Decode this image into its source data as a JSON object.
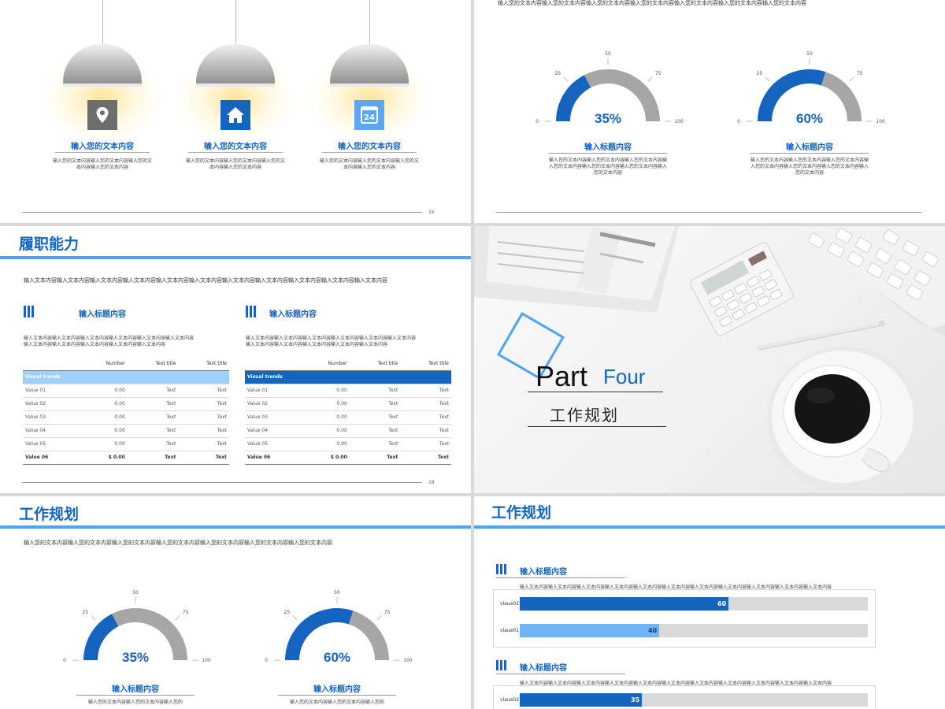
{
  "slide1": {
    "items": [
      {
        "icon": "location-pin-icon",
        "icon_bg": "#6d6d6d",
        "title": "输入您的文本内容",
        "text": "输入您的文本内容输入您的文本内容输入您的文本内容输入您的文本内容"
      },
      {
        "icon": "home-icon",
        "icon_bg": "#1565c0",
        "title": "输入您的文本内容",
        "text": "输入您的文本内容输入您的文本内容输入您的文本内容输入您的文本内容"
      },
      {
        "icon": "calendar-icon",
        "icon_bg": "#5ba8f0",
        "icon_text": "24",
        "title": "输入您的文本内容",
        "text": "输入您的文本内容输入您的文本内容输入您的文本内容输入您的文本内容"
      }
    ],
    "page_number": "16"
  },
  "slide2": {
    "intro": "输入您的文本内容输入您的文本内容输入您的文本内容输入您的文本内容输入您的文本内容输入您的文本内容输入您的文本内容",
    "gauges": [
      {
        "value": 35,
        "label": "35%",
        "title": "输入标题内容",
        "text": "输入您的文本内容输入您的文本内容输入您的文本内容输入您的文本内容输入您的文本内容输入您的文本内容输入您的文本内容"
      },
      {
        "value": 60,
        "label": "60%",
        "title": "输入标题内容",
        "text": "输入您的文本内容输入您的文本内容输入您的文本内容输入您的文本内容输入您的文本内容输入您的文本内容输入您的文本内容"
      }
    ],
    "ticks": [
      "0",
      "25",
      "50",
      "75",
      "100"
    ]
  },
  "slide3": {
    "title": "履职能力",
    "intro": "输入文本内容输入文本内容输入文本内容输入文本内容输入文本内容输入文本内容输入文本内容输入文本内容输入文本内容输入文本内容输入文本内容",
    "tables": [
      {
        "heading": "输入标题内容",
        "desc": "输入文本内容输入文本内容输入文本内容输入文本内容输入文本内容输入文本内容输入文本内容输入文本内容输入文本内容输入文本内容输入文本内容",
        "columns": [
          "Number",
          "Text title",
          "Text title"
        ],
        "header_row": "Visual trends",
        "rows": [
          [
            "Value 01",
            "0.00",
            "Text",
            "Text"
          ],
          [
            "Value 02",
            "0.00",
            "Text",
            "Text"
          ],
          [
            "Value 03",
            "0.00",
            "Text",
            "Text"
          ],
          [
            "Value 04",
            "0.00",
            "Text",
            "Text"
          ],
          [
            "Value 05",
            "0.00",
            "Text",
            "Text"
          ],
          [
            "Value 06",
            "$ 0.00",
            "Text",
            "Text"
          ]
        ]
      },
      {
        "heading": "输入标题内容",
        "desc": "输入文本内容输入文本内容输入文本内容输入文本内容输入文本内容输入文本内容输入文本内容输入文本内容输入文本内容输入文本内容输入文本内容",
        "columns": [
          "Number",
          "Text title",
          "Text title"
        ],
        "header_row": "Visual trends",
        "rows": [
          [
            "Value 01",
            "0.00",
            "Text",
            "Text"
          ],
          [
            "Value 02",
            "0.00",
            "Text",
            "Text"
          ],
          [
            "Value 03",
            "0.00",
            "Text",
            "Text"
          ],
          [
            "Value 04",
            "0.00",
            "Text",
            "Text"
          ],
          [
            "Value 05",
            "0.00",
            "Text",
            "Text"
          ],
          [
            "Value 06",
            "$ 0.00",
            "Text",
            "Text"
          ]
        ]
      }
    ],
    "page_number": "18"
  },
  "slide4": {
    "part_word": "Part",
    "part_number": "Four",
    "subtitle": "工作规划"
  },
  "slide5": {
    "title": "工作规划",
    "intro": "输入您的文本内容输入您的文本内容输入您的文本内容输入您的文本内容输入您的文本内容输入您的文本内容输入您的文本内容",
    "gauges": [
      {
        "value": 35,
        "label": "35%",
        "title": "输入标题内容",
        "text": "输入您的文本内容输入您的文本内容输入您的"
      },
      {
        "value": 60,
        "label": "60%",
        "title": "输入标题内容",
        "text": "输入您的文本内容输入您的文本内容输入您的"
      }
    ],
    "ticks": [
      "0",
      "25",
      "50",
      "75",
      "100"
    ]
  },
  "slide6": {
    "title": "工作规划",
    "charts": [
      {
        "heading": "输入标题内容",
        "desc": "输入文本内容输入文本内容输入文本内容输入文本内容输入文本内容输入文本内容输入文本内容输入文本内容输入文本内容输入文本内容输入文本内容",
        "bars": [
          {
            "category": "vlaue02",
            "value": 60,
            "label": "60",
            "color": "#1565c0"
          },
          {
            "category": "vlaue01",
            "value": 40,
            "label": "40",
            "color": "#6fb4f5"
          }
        ]
      },
      {
        "heading": "输入标题内容",
        "desc": "输入文本内容输入文本内容输入文本内容输入文本内容输入文本内容输入文本内容输入文本内容输入文本内容输入文本内容输入文本内容输入文本内容",
        "bars": [
          {
            "category": "vlaue02",
            "value": 35,
            "label": "35",
            "color": "#1565c0"
          }
        ]
      }
    ]
  },
  "colors": {
    "accent": "#1565c0",
    "light_accent": "#4fa3f3",
    "gauge_gray": "#a6a6a6"
  },
  "chart_data": [
    {
      "type": "bar",
      "categories": [
        "vlaue02",
        "vlaue01"
      ],
      "values": [
        60,
        40
      ],
      "xlim": [
        0,
        100
      ]
    },
    {
      "type": "bar",
      "categories": [
        "vlaue02"
      ],
      "values": [
        35
      ],
      "xlim": [
        0,
        100
      ]
    }
  ]
}
